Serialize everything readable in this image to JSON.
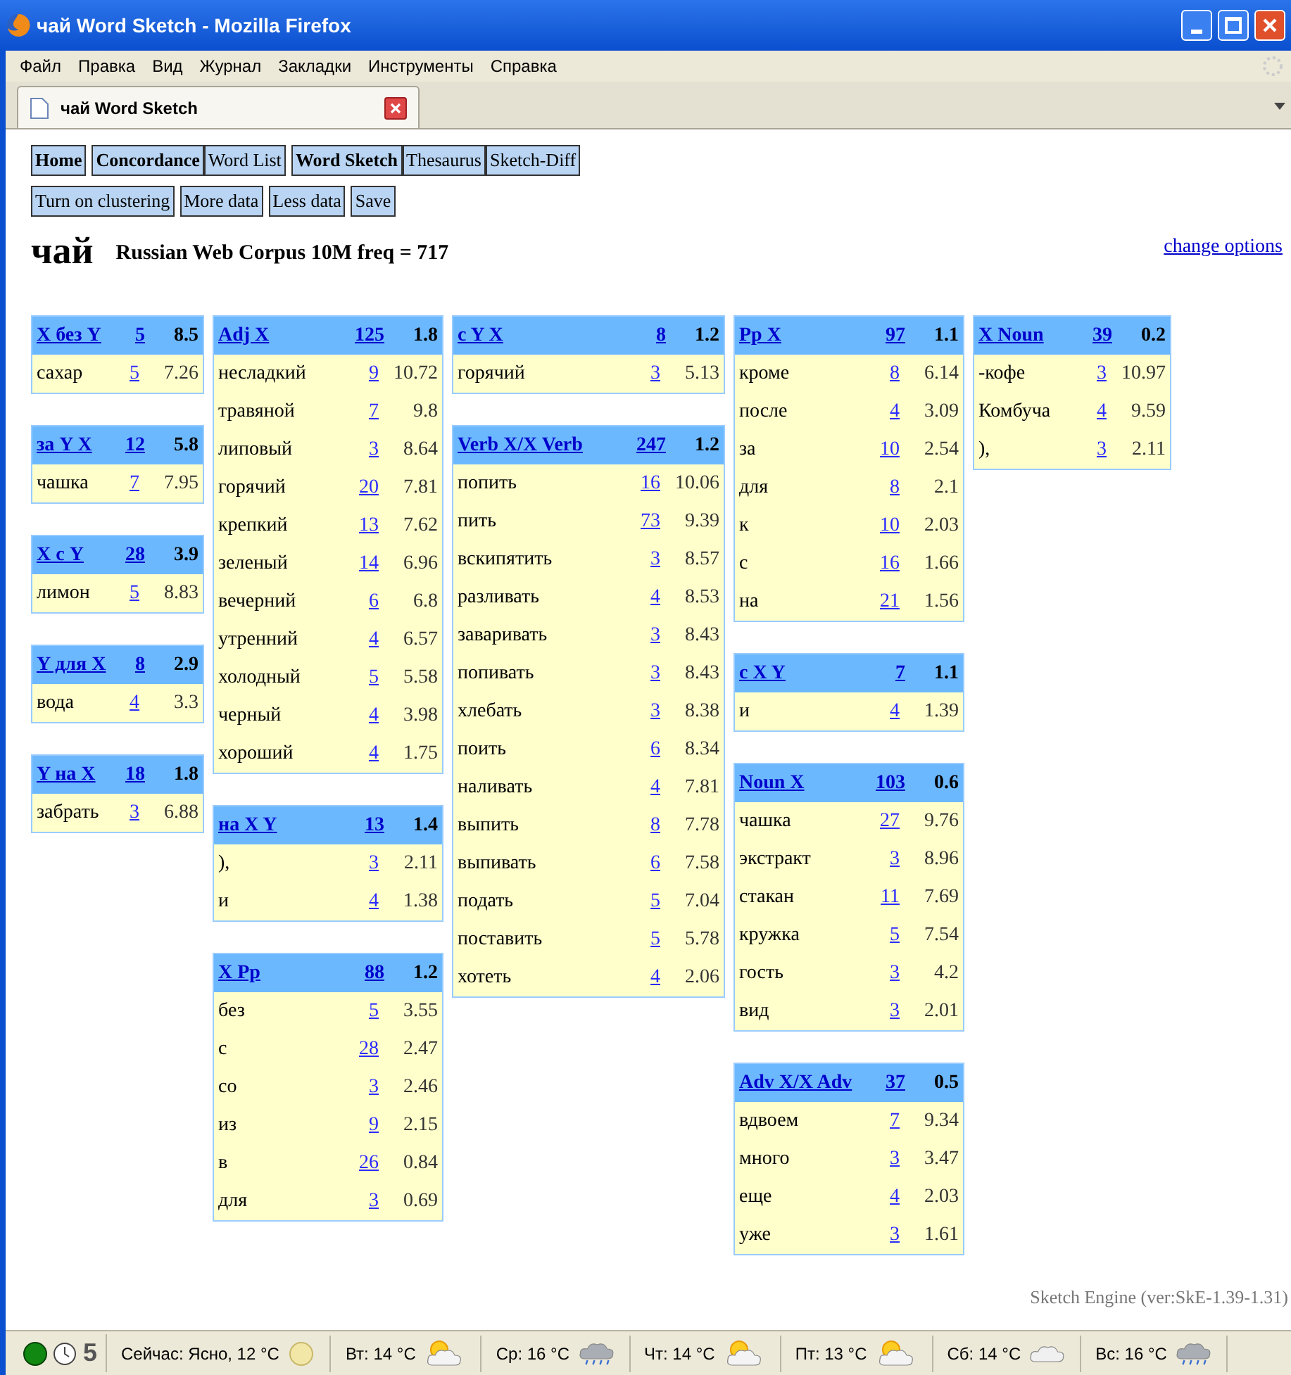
{
  "window": {
    "title": "чай Word Sketch - Mozilla Firefox"
  },
  "menu": [
    "Файл",
    "Правка",
    "Вид",
    "Журнал",
    "Закладки",
    "Инструменты",
    "Справка"
  ],
  "tab": {
    "label": "чай Word Sketch"
  },
  "nav_groups": [
    [
      {
        "label": "Home",
        "kind": "main"
      }
    ],
    [
      {
        "label": "Concordance",
        "kind": "main"
      },
      {
        "label": "Word List",
        "kind": "sub"
      }
    ],
    [
      {
        "label": "Word Sketch",
        "kind": "main"
      },
      {
        "label": "Thesaurus",
        "kind": "sub"
      },
      {
        "label": "Sketch-Diff",
        "kind": "sub"
      }
    ]
  ],
  "actions": [
    "Turn on clustering",
    "More data",
    "Less data",
    "Save"
  ],
  "headword": "чай",
  "corpus_info": "Russian Web Corpus 10M freq = 717",
  "change_options": "change options",
  "columns": [
    [
      {
        "title": "X без Y",
        "count": "5",
        "score": "8.5",
        "rows": [
          {
            "word": "сахар",
            "count": "5",
            "score": "7.26"
          }
        ]
      },
      {
        "title": "за Y X",
        "count": "12",
        "score": "5.8",
        "rows": [
          {
            "word": "чашка",
            "count": "7",
            "score": "7.95"
          }
        ]
      },
      {
        "title": "X с Y",
        "count": "28",
        "score": "3.9",
        "rows": [
          {
            "word": "лимон",
            "count": "5",
            "score": "8.83"
          }
        ]
      },
      {
        "title": "Y для X",
        "count": "8",
        "score": "2.9",
        "rows": [
          {
            "word": "вода",
            "count": "4",
            "score": "3.3"
          }
        ]
      },
      {
        "title": "Y на X",
        "count": "18",
        "score": "1.8",
        "rows": [
          {
            "word": "забрать",
            "count": "3",
            "score": "6.88"
          }
        ]
      }
    ],
    [
      {
        "title": "Adj X",
        "count": "125",
        "score": "1.8",
        "rows": [
          {
            "word": "несладкий",
            "count": "9",
            "score": "10.72"
          },
          {
            "word": "травяной",
            "count": "7",
            "score": "9.8"
          },
          {
            "word": "липовый",
            "count": "3",
            "score": "8.64"
          },
          {
            "word": "горячий",
            "count": "20",
            "score": "7.81"
          },
          {
            "word": "крепкий",
            "count": "13",
            "score": "7.62"
          },
          {
            "word": "зеленый",
            "count": "14",
            "score": "6.96"
          },
          {
            "word": "вечерний",
            "count": "6",
            "score": "6.8"
          },
          {
            "word": "утренний",
            "count": "4",
            "score": "6.57"
          },
          {
            "word": "холодный",
            "count": "5",
            "score": "5.58"
          },
          {
            "word": "черный",
            "count": "4",
            "score": "3.98"
          },
          {
            "word": "хороший",
            "count": "4",
            "score": "1.75"
          }
        ]
      },
      {
        "title": "на X Y",
        "count": "13",
        "score": "1.4",
        "rows": [
          {
            "word": "),",
            "count": "3",
            "score": "2.11"
          },
          {
            "word": "и",
            "count": "4",
            "score": "1.38"
          }
        ]
      },
      {
        "title": "X Pp",
        "count": "88",
        "score": "1.2",
        "rows": [
          {
            "word": "без",
            "count": "5",
            "score": "3.55"
          },
          {
            "word": "с",
            "count": "28",
            "score": "2.47"
          },
          {
            "word": "со",
            "count": "3",
            "score": "2.46"
          },
          {
            "word": "из",
            "count": "9",
            "score": "2.15"
          },
          {
            "word": "в",
            "count": "26",
            "score": "0.84"
          },
          {
            "word": "для",
            "count": "3",
            "score": "0.69"
          }
        ]
      }
    ],
    [
      {
        "title": "c Y X",
        "count": "8",
        "score": "1.2",
        "rows": [
          {
            "word": "горячий",
            "count": "3",
            "score": "5.13"
          }
        ]
      },
      {
        "title": "Verb X/X Verb",
        "count": "247",
        "score": "1.2",
        "rows": [
          {
            "word": "попить",
            "count": "16",
            "score": "10.06"
          },
          {
            "word": "пить",
            "count": "73",
            "score": "9.39"
          },
          {
            "word": "вскипятить",
            "count": "3",
            "score": "8.57"
          },
          {
            "word": "разливать",
            "count": "4",
            "score": "8.53"
          },
          {
            "word": "заваривать",
            "count": "3",
            "score": "8.43"
          },
          {
            "word": "попивать",
            "count": "3",
            "score": "8.43"
          },
          {
            "word": "хлебать",
            "count": "3",
            "score": "8.38"
          },
          {
            "word": "поить",
            "count": "6",
            "score": "8.34"
          },
          {
            "word": "наливать",
            "count": "4",
            "score": "7.81"
          },
          {
            "word": "выпить",
            "count": "8",
            "score": "7.78"
          },
          {
            "word": "выпивать",
            "count": "6",
            "score": "7.58"
          },
          {
            "word": "подать",
            "count": "5",
            "score": "7.04"
          },
          {
            "word": "поставить",
            "count": "5",
            "score": "5.78"
          },
          {
            "word": "хотеть",
            "count": "4",
            "score": "2.06"
          }
        ]
      }
    ],
    [
      {
        "title": "Pp X",
        "count": "97",
        "score": "1.1",
        "rows": [
          {
            "word": "кроме",
            "count": "8",
            "score": "6.14"
          },
          {
            "word": "после",
            "count": "4",
            "score": "3.09"
          },
          {
            "word": "за",
            "count": "10",
            "score": "2.54"
          },
          {
            "word": "для",
            "count": "8",
            "score": "2.1"
          },
          {
            "word": "к",
            "count": "10",
            "score": "2.03"
          },
          {
            "word": "с",
            "count": "16",
            "score": "1.66"
          },
          {
            "word": "на",
            "count": "21",
            "score": "1.56"
          }
        ]
      },
      {
        "title": "c X Y",
        "count": "7",
        "score": "1.1",
        "rows": [
          {
            "word": "и",
            "count": "4",
            "score": "1.39"
          }
        ]
      },
      {
        "title": "Noun X",
        "count": "103",
        "score": "0.6",
        "rows": [
          {
            "word": "чашка",
            "count": "27",
            "score": "9.76"
          },
          {
            "word": "экстракт",
            "count": "3",
            "score": "8.96"
          },
          {
            "word": "стакан",
            "count": "11",
            "score": "7.69"
          },
          {
            "word": "кружка",
            "count": "5",
            "score": "7.54"
          },
          {
            "word": "гость",
            "count": "3",
            "score": "4.2"
          },
          {
            "word": "вид",
            "count": "3",
            "score": "2.01"
          }
        ]
      },
      {
        "title": "Adv X/X Adv",
        "count": "37",
        "score": "0.5",
        "rows": [
          {
            "word": "вдвоем",
            "count": "7",
            "score": "9.34"
          },
          {
            "word": "много",
            "count": "3",
            "score": "3.47"
          },
          {
            "word": "еще",
            "count": "4",
            "score": "2.03"
          },
          {
            "word": "уже",
            "count": "3",
            "score": "1.61"
          }
        ]
      }
    ],
    [
      {
        "title": "X Noun",
        "count": "39",
        "score": "0.2",
        "rows": [
          {
            "word": "-кофе",
            "count": "3",
            "score": "10.97"
          },
          {
            "word": "Комбуча",
            "count": "4",
            "score": "9.59"
          },
          {
            "word": "),",
            "count": "3",
            "score": "2.11"
          }
        ]
      }
    ]
  ],
  "footer": "Sketch Engine (ver:SkE-1.39-1.31)",
  "status_bar": {
    "counter": "5",
    "weather": [
      {
        "text": "Сейчас: Ясно, 12 °C",
        "kind": "moon"
      },
      {
        "text": "Вт: 14 °C",
        "kind": "sun-cloud"
      },
      {
        "text": "Ср: 16 °C",
        "kind": "rain"
      },
      {
        "text": "Чт: 14 °C",
        "kind": "sun-cloud"
      },
      {
        "text": "Пт: 13 °C",
        "kind": "sun-cloud"
      },
      {
        "text": "Сб: 14 °C",
        "kind": "cloud"
      },
      {
        "text": "Вс: 16 °C",
        "kind": "rain"
      }
    ]
  }
}
